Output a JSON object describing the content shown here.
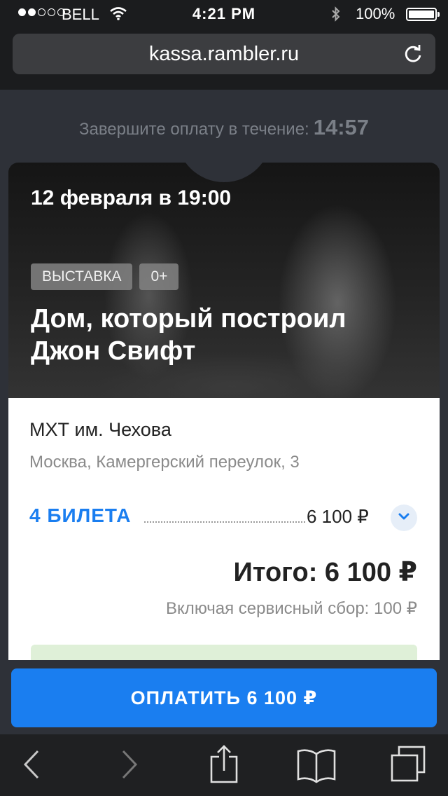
{
  "status_bar": {
    "carrier": "BELL",
    "time": "4:21 PM",
    "battery_percent": "100%",
    "signal_bars_filled": 2,
    "signal_bars_total": 5,
    "icons": [
      "wifi-icon",
      "bluetooth-icon",
      "battery-icon"
    ]
  },
  "browser": {
    "url": "kassa.rambler.ru",
    "reload_icon": "reload-icon"
  },
  "checkout": {
    "timer_label": "Завершите оплату в течение:",
    "timer_value": "14:57"
  },
  "event": {
    "date": "12 февраля в 19:00",
    "tags": [
      "ВЫСТАВКА",
      "0+"
    ],
    "title": "Дом, который построил Джон Свифт",
    "venue": "МХТ им. Чехова",
    "address": "Москва, Камергерский переулок, 3"
  },
  "order": {
    "tickets_label": "4 БИЛЕТА",
    "tickets_price": "6 100 ₽",
    "total": "Итого: 6 100 ₽",
    "service_fee": "Включая сервисный сбор: 100 ₽"
  },
  "pay_button": {
    "label": "ОПЛАТИТЬ 6 100 ₽"
  },
  "colors": {
    "accent": "#1a7ef0",
    "background": "#2e3138"
  },
  "toolbar": {
    "icons": [
      "back-icon",
      "forward-icon",
      "share-icon",
      "bookmarks-icon",
      "tabs-icon"
    ]
  }
}
